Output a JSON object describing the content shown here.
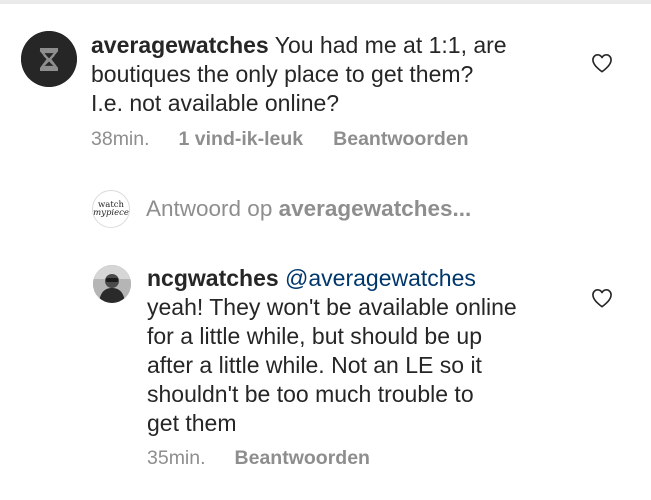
{
  "comments": [
    {
      "username": "averagewatches",
      "text": "You had me at 1:1, are boutiques the only place to get them? I.e. not available online?",
      "lines": [
        "You had me at 1:1, are",
        "boutiques the only place to get them?",
        "I.e. not available online?"
      ],
      "time": "38min.",
      "likes": "1 vind-ik-leuk",
      "reply_label": "Beantwoorden"
    },
    {
      "username": "ncgwatches",
      "mention": "@averagewatches",
      "lines": [
        "yeah! They won't be available online",
        "for a little while, but should be up",
        "after a little while. Not an LE so it",
        "shouldn't be too much trouble to",
        "get them"
      ],
      "time": "35min.",
      "reply_label": "Beantwoorden"
    }
  ],
  "reply_thread": {
    "prefix": "Antwoord op",
    "username": "averagewatches",
    "ellipsis": "...",
    "avatar_logo_line1": "watch",
    "avatar_logo_line2": "mypiece"
  },
  "icons": {
    "heart": "heart-outline-icon",
    "avatar_main": "hourglass-logo-icon"
  },
  "colors": {
    "text": "#262626",
    "secondary": "#8e8e8e",
    "mention": "#00376b"
  }
}
